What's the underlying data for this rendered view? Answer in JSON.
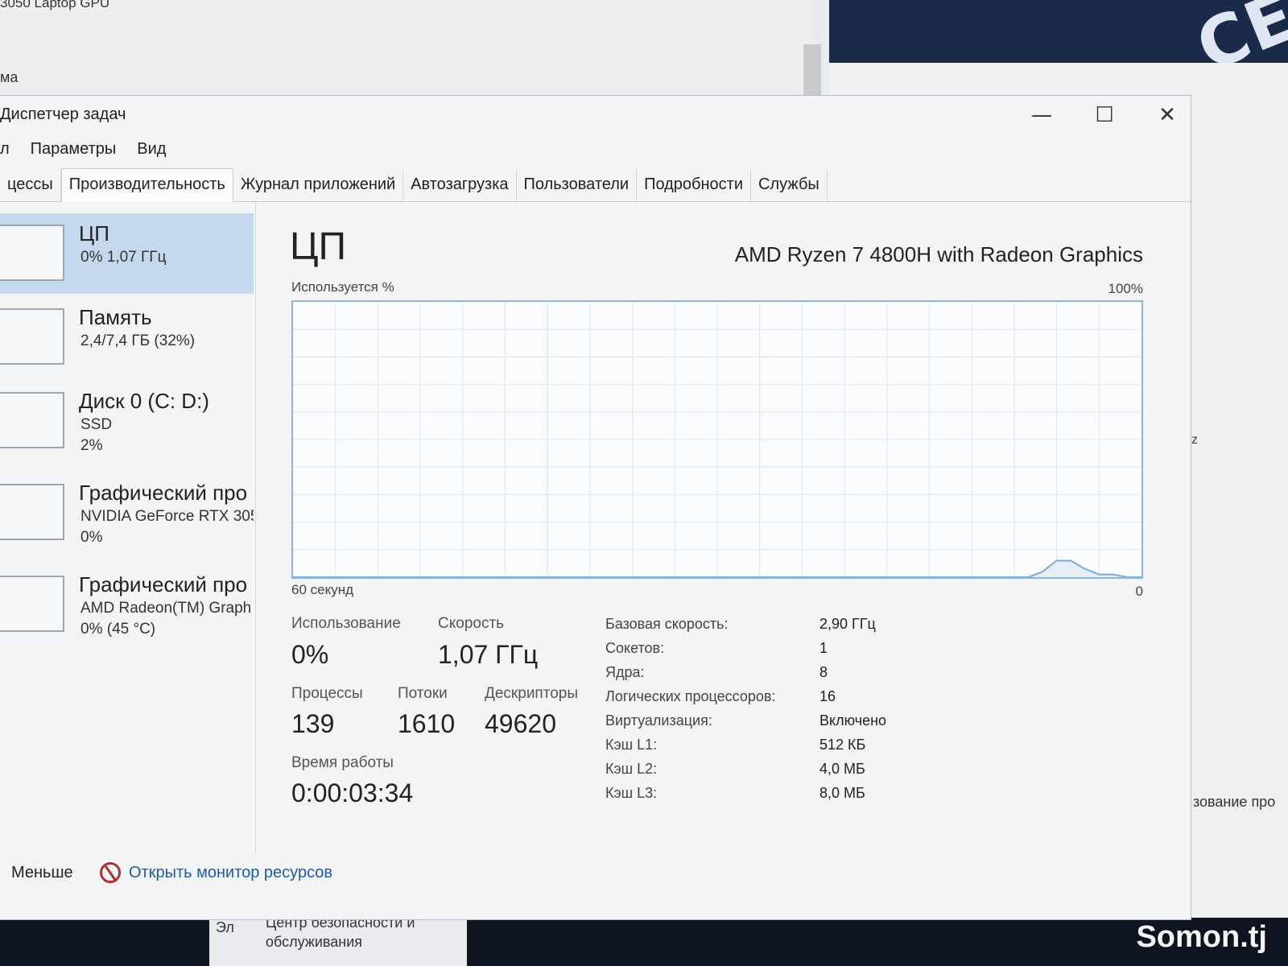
{
  "background": {
    "top_left_line1": "3050 Laptop GPU",
    "top_left_line2": "ма",
    "dark_logo_text": "CE",
    "right_frag1": "z",
    "right_frag2": "зование про",
    "bottom_ela": "Эл",
    "bottom_line1": "Центр безопасности и",
    "bottom_line2": "обслуживания",
    "watermark": "Somon.tj"
  },
  "window": {
    "title": "Диспетчер задач",
    "min_glyph": "—",
    "max_glyph": "☐",
    "close_glyph": "✕"
  },
  "menu": [
    "л",
    "Параметры",
    "Вид"
  ],
  "tabs": [
    {
      "label": "цессы",
      "active": false
    },
    {
      "label": "Производительность",
      "active": true
    },
    {
      "label": "Журнал приложений",
      "active": false
    },
    {
      "label": "Автозагрузка",
      "active": false
    },
    {
      "label": "Пользователи",
      "active": false
    },
    {
      "label": "Подробности",
      "active": false
    },
    {
      "label": "Службы",
      "active": false
    }
  ],
  "sidebar": [
    {
      "name": "ЦП",
      "line2": "0% 1,07 ГГц",
      "line3": ""
    },
    {
      "name": "Память",
      "line2": "2,4/7,4 ГБ (32%)",
      "line3": ""
    },
    {
      "name": "Диск 0 (C: D:)",
      "line2": "SSD",
      "line3": "2%"
    },
    {
      "name": "Графический про",
      "line2": "NVIDIA GeForce RTX 305",
      "line3": "0%"
    },
    {
      "name": "Графический про",
      "line2": "AMD Radeon(TM) Graph",
      "line3": "0% (45 °C)"
    }
  ],
  "main": {
    "title": "ЦП",
    "model": "AMD Ryzen 7 4800H with Radeon Graphics",
    "util_label": "Используется %",
    "max_label": "100%",
    "time_label": "60 секунд",
    "zero_label": "0"
  },
  "chart_data": {
    "type": "area",
    "x": [
      60,
      8,
      7,
      6,
      5,
      4,
      3,
      2,
      1,
      0
    ],
    "values": [
      0,
      0,
      2,
      6,
      6,
      3,
      1,
      1,
      0,
      0
    ],
    "ylim": [
      0,
      100
    ],
    "xlim": [
      60,
      0
    ],
    "grid": true,
    "color": "#7fa9d6"
  },
  "stats": {
    "usage_label": "Использование",
    "usage_value": "0%",
    "speed_label": "Скорость",
    "speed_value": "1,07 ГГц",
    "processes_label": "Процессы",
    "processes_value": "139",
    "threads_label": "Потоки",
    "threads_value": "1610",
    "handles_label": "Дескрипторы",
    "handles_value": "49620",
    "uptime_label": "Время работы",
    "uptime_value": "0:00:03:34"
  },
  "specs": [
    {
      "key": "Базовая скорость:",
      "value": "2,90 ГГц"
    },
    {
      "key": "Сокетов:",
      "value": "1"
    },
    {
      "key": "Ядра:",
      "value": "8"
    },
    {
      "key": "Логических процессоров:",
      "value": "16"
    },
    {
      "key": "Виртуализация:",
      "value": "Включено"
    },
    {
      "key": "Кэш L1:",
      "value": "512 КБ"
    },
    {
      "key": "Кэш L2:",
      "value": "4,0 МБ"
    },
    {
      "key": "Кэш L3:",
      "value": "8,0 МБ"
    }
  ],
  "footer": {
    "less": "Меньше",
    "resource_monitor": "Открыть монитор ресурсов",
    "monitor_icon": "resource-monitor-icon"
  }
}
